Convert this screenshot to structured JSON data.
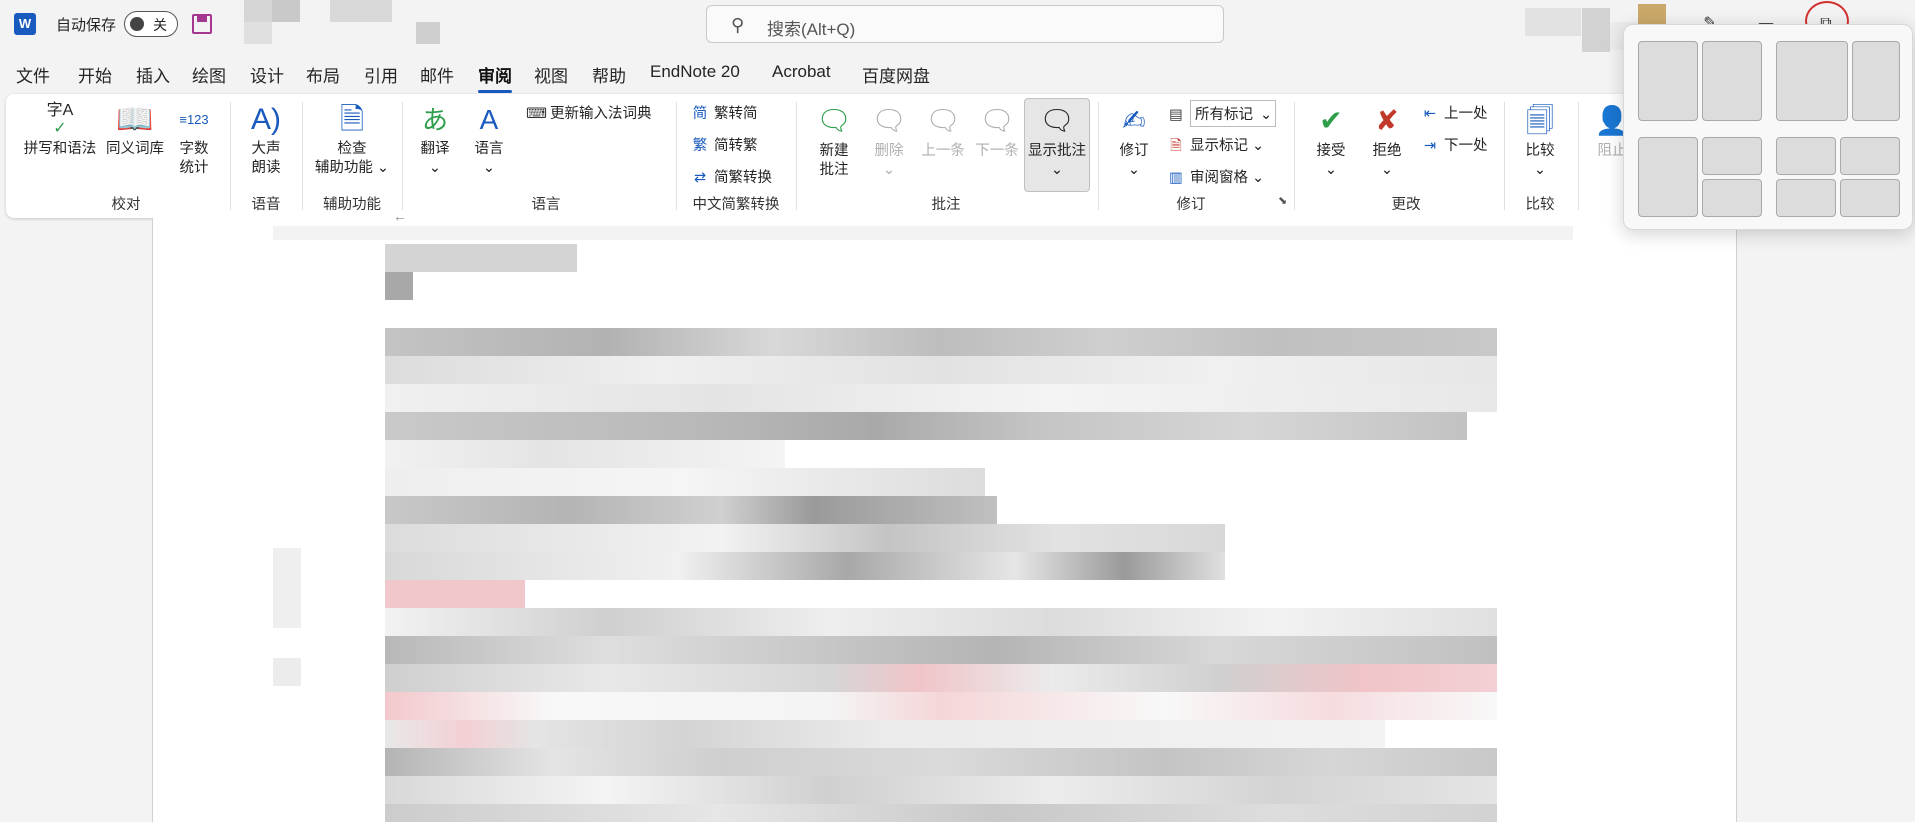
{
  "titlebar": {
    "app_icon": "W",
    "autosave_label": "自动保存",
    "autosave_state": "关",
    "search_placeholder": "搜索(Alt+Q)"
  },
  "tabs": [
    "文件",
    "开始",
    "插入",
    "绘图",
    "设计",
    "布局",
    "引用",
    "邮件",
    "审阅",
    "视图",
    "帮助",
    "EndNote 20",
    "Acrobat",
    "百度网盘"
  ],
  "active_tab": "审阅",
  "ribbon": {
    "proofing": {
      "spell_icon_text": "字A",
      "spell": "拼写和语法",
      "thesaurus": "同义词库",
      "wordcount_icon_text": "123",
      "wordcount_1": "字数",
      "wordcount_2": "统计",
      "group": "校对"
    },
    "speech": {
      "readaloud_1": "大声",
      "readaloud_2": "朗读",
      "group": "语音"
    },
    "accessibility": {
      "check_1": "检查",
      "check_2": "辅助功能",
      "group": "辅助功能"
    },
    "language": {
      "translate": "翻译",
      "language": "语言",
      "update_ime": "更新输入法词典",
      "group": "语言"
    },
    "chinese": {
      "to_trad_icon": "简",
      "to_simp_icon": "繁",
      "to_trad": "繁转简",
      "to_simp": "简转繁",
      "convert": "简繁转换",
      "group": "中文简繁转换"
    },
    "comments": {
      "new_1": "新建",
      "new_2": "批注",
      "delete": "删除",
      "prev": "上一条",
      "next": "下一条",
      "show": "显示批注",
      "group": "批注"
    },
    "tracking": {
      "track": "修订",
      "markup_dropdown": "所有标记",
      "show_markup": "显示标记",
      "review_pane": "审阅窗格",
      "group": "修订"
    },
    "changes": {
      "accept": "接受",
      "reject": "拒绝",
      "previous": "上一处",
      "next": "下一处",
      "group": "更改"
    },
    "compare": {
      "compare": "比较",
      "group": "比较"
    },
    "protect": {
      "block": "阻止"
    }
  }
}
